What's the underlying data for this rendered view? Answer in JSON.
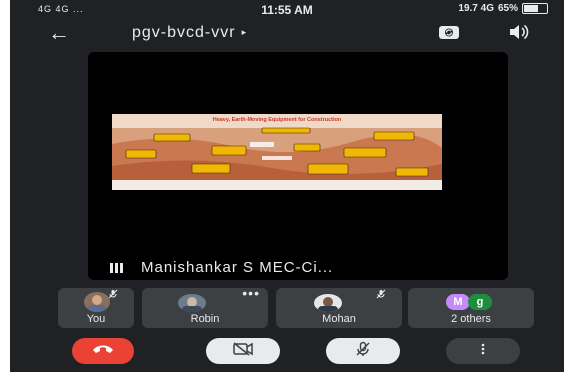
{
  "status_bar": {
    "signal_text": "4G 4G ...",
    "time": "11:55 AM",
    "network_text": "19.7 4G",
    "battery": "65%",
    "battery_level": 0.65
  },
  "header": {
    "meeting_code": "pgv-bvcd-vvr",
    "caret": "▸"
  },
  "main_tile": {
    "presenter_name": "Manishankar S MEC-Ci...",
    "slide_title": "Heavy, Earth-Moving Equipment for Construction"
  },
  "participants": [
    {
      "name": "You",
      "muted": true
    },
    {
      "name": "Robin",
      "muted": false,
      "more": "•••"
    },
    {
      "name": "Mohan",
      "muted": true
    },
    {
      "name": "2 others",
      "badges": [
        "M",
        "g"
      ]
    }
  ],
  "colors": {
    "background": "#202124",
    "tile": "#3c4043",
    "end_call": "#ea4335",
    "badge_m": "#c58af9",
    "badge_g": "#1e8e3e"
  },
  "icons": {
    "back": "arrow-left-icon",
    "camera_switch": "camera-switch-icon",
    "speaker": "speaker-icon",
    "end_call": "phone-hangup-icon",
    "camera_off": "video-off-icon",
    "mic_off": "mic-off-icon",
    "more": "more-vertical-icon"
  }
}
